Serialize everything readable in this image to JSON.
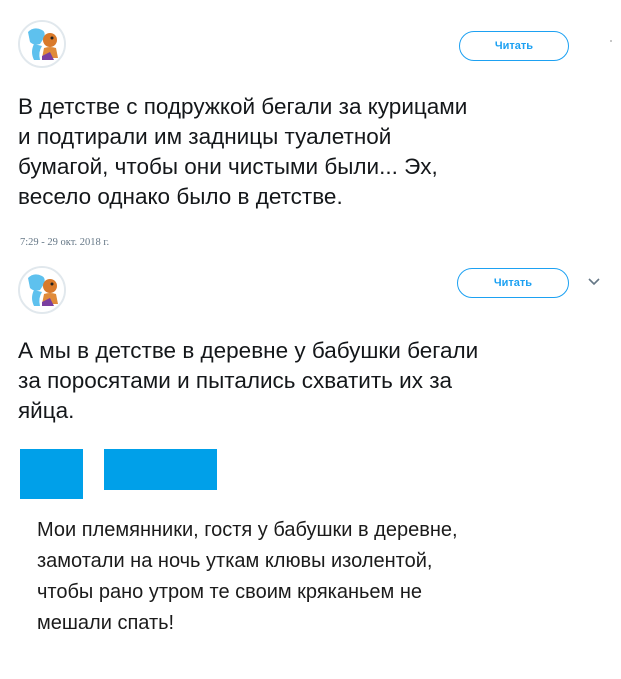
{
  "tweets": [
    {
      "follow_label": "Читать",
      "lines": [
        "В детстве с подружкой бегали за курицами",
        "и подтирали им задницы туалетной",
        "бумагой, чтобы они чистыми были... Эх,",
        "весело однако было в детстве."
      ],
      "timestamp": "7:29 - 29 окт. 2018 г."
    },
    {
      "follow_label": "Читать",
      "lines": [
        "А мы в детстве в деревне у бабушки бегали",
        "за поросятами и пытались схватить их за",
        "яйца."
      ]
    }
  ],
  "comment": {
    "lines": [
      "Мои племянники, гостя у бабушки в деревне,",
      "замотали на ночь уткам клювы изолентой,",
      "чтобы рано утром те своим кряканьем не",
      "мешали спать!"
    ]
  },
  "colors": {
    "accent": "#1da1f2",
    "redaction": "#00a0e9",
    "text": "#14171a",
    "muted": "#657786"
  },
  "icons": [
    "avatar-cartoon-icon",
    "chevron-down-icon"
  ]
}
